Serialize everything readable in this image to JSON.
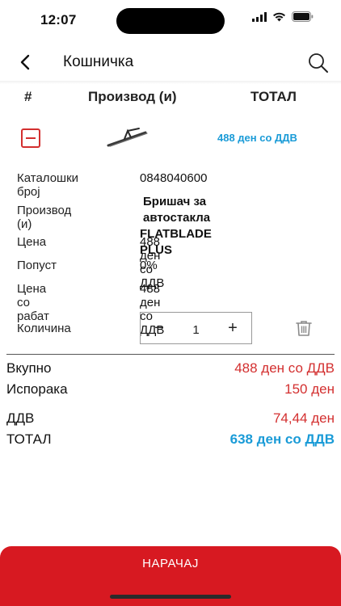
{
  "status_bar": {
    "time": "12:07"
  },
  "nav": {
    "title": "Кошничка"
  },
  "table_header": {
    "num": "#",
    "product": "Производ (и)",
    "total": "ТОТАЛ"
  },
  "item": {
    "row_total": "488  ден со ДДВ",
    "details": {
      "catalog_label": "Каталошки број",
      "catalog_value": "0848040600",
      "product_label": "Производ (и)",
      "product_value_line1": "Бришач за автостакла",
      "product_value_line2": "FLATBLADE PLUS",
      "price_label": "Цена",
      "price_value": "488  ден со ДДВ",
      "discount_label": "Попуст",
      "discount_value": "0%",
      "discounted_price_label": "Цена со рабат",
      "discounted_price_value": "488  ден со ДДВ",
      "quantity_label": "Количина",
      "quantity_value": "1",
      "minus": "−",
      "plus": "+"
    }
  },
  "summary": {
    "subtotal_label": "Вкупно",
    "subtotal_value": "488  ден со ДДВ",
    "shipping_label": "Испорака",
    "shipping_value": "150  ден",
    "vat_label": "ДДВ",
    "vat_value": "74,44  ден",
    "total_label": "ТОТАЛ",
    "total_value": "638  ден со ДДВ"
  },
  "order_button": {
    "label": "НАРАЧАЈ"
  },
  "icons": {
    "back": "chevron-left-icon",
    "search": "search-icon",
    "remove": "minus-square-icon",
    "delete": "trash-icon",
    "signal": "signal-icon",
    "wifi": "wifi-icon",
    "battery": "battery-icon"
  },
  "colors": {
    "accent_red": "#d71921",
    "price_red": "#d32f2f",
    "total_blue": "#1a9bd7"
  }
}
